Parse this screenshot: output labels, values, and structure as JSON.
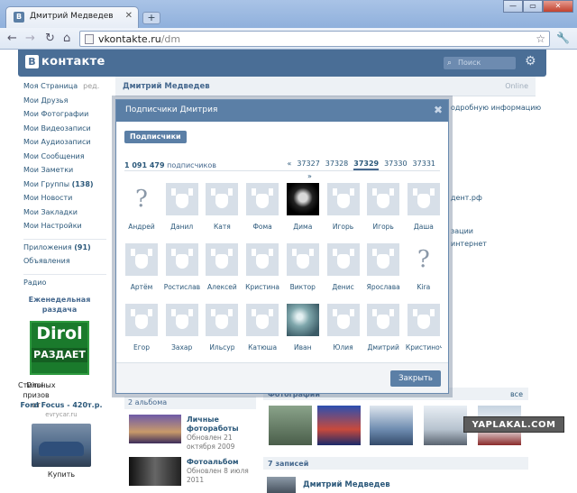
{
  "browser": {
    "tab_title": "Дмитрий Медведев",
    "tab_favicon": "В",
    "tab_close": "✕",
    "new_tab": "+",
    "window_buttons": [
      "—",
      "▭",
      "✕"
    ],
    "url_host": "vkontakte.ru",
    "url_path": "/dm",
    "icons": {
      "back": "←",
      "forward": "→",
      "reload": "↻",
      "home": "⌂",
      "star": "☆",
      "wrench": "🔧"
    }
  },
  "vk": {
    "logo_letter": "В",
    "logo_text": "контакте",
    "search_placeholder": "Поиск",
    "sidebar": [
      {
        "label": "Моя Страница",
        "aux": "ред."
      },
      {
        "label": "Мои Друзья"
      },
      {
        "label": "Мои Фотографии"
      },
      {
        "label": "Мои Видеозаписи"
      },
      {
        "label": "Мои Аудиозаписи"
      },
      {
        "label": "Мои Сообщения"
      },
      {
        "label": "Мои Заметки"
      },
      {
        "label": "Мои Группы",
        "count": "(138)"
      },
      {
        "label": "Мои Новости"
      },
      {
        "label": "Мои Закладки"
      },
      {
        "label": "Мои Настройки"
      }
    ],
    "sidebar2": [
      {
        "label": "Приложения",
        "count": "(91)"
      },
      {
        "label": "Объявления"
      }
    ],
    "sidebar3": [
      {
        "label": "Радио"
      }
    ],
    "promo": {
      "title_line1": "Еженедельная",
      "title_line2": "раздача",
      "banner_top": "Dirol",
      "banner_bottom": "РАЗДАЕТ",
      "text_line1": "Стильных призов от",
      "text_line2": "Dirol."
    },
    "ford": {
      "title": "Ford Focus - 420т.р.",
      "site": "evrycar.ru",
      "buy": "Купить"
    },
    "profile_name": "Дмитрий Медведев",
    "online": "Online",
    "fragments": {
      "f1": "одробную информацию",
      "f2": "дент.рф",
      "f3": "зации",
      "f4": "интернет"
    },
    "albums_header": "2 альбома",
    "albums": [
      {
        "title": "Личные фотоработы",
        "updated": "Обновлен 21 октября 2009"
      },
      {
        "title": "Фотоальбом",
        "updated": "Обновлен 8 июля 2011"
      }
    ],
    "photos_header": "Фотографии",
    "photos_all": "все",
    "posts_header": "7 записей",
    "poster_name": "Дмитрий Медведев"
  },
  "modal": {
    "title": "Подписчики Дмитрия",
    "close": "✖",
    "tab_label": "Подписчики",
    "count_number": "1 091 479",
    "count_label": "подписчиков",
    "pager": {
      "prev": "«",
      "pages": [
        "37327",
        "37328",
        "37329",
        "37330",
        "37331"
      ],
      "current": "37329",
      "next": "»"
    },
    "subscribers": [
      {
        "name": "Андрей",
        "avatar": "unknown"
      },
      {
        "name": "Данил",
        "avatar": "dog"
      },
      {
        "name": "Катя",
        "avatar": "dog"
      },
      {
        "name": "Фома",
        "avatar": "dog"
      },
      {
        "name": "Дима",
        "avatar": "photo-dark"
      },
      {
        "name": "Игорь",
        "avatar": "dog"
      },
      {
        "name": "Игорь",
        "avatar": "dog"
      },
      {
        "name": "Даша",
        "avatar": "dog"
      },
      {
        "name": "Артём",
        "avatar": "dog"
      },
      {
        "name": "Ростислав",
        "avatar": "dog"
      },
      {
        "name": "Алексей",
        "avatar": "dog"
      },
      {
        "name": "Кристина",
        "avatar": "dog"
      },
      {
        "name": "Виктор",
        "avatar": "dog"
      },
      {
        "name": "Денис",
        "avatar": "dog"
      },
      {
        "name": "Ярослава",
        "avatar": "dog"
      },
      {
        "name": "Kira",
        "avatar": "unknown"
      },
      {
        "name": "Егор",
        "avatar": "dog"
      },
      {
        "name": "Захар",
        "avatar": "dog"
      },
      {
        "name": "Ильсур",
        "avatar": "dog"
      },
      {
        "name": "Катюша",
        "avatar": "dog"
      },
      {
        "name": "Иван",
        "avatar": "photo-sea"
      },
      {
        "name": "Юлия",
        "avatar": "dog"
      },
      {
        "name": "Дмитрий",
        "avatar": "dog"
      },
      {
        "name": "Кристиночк",
        "avatar": "dog"
      }
    ],
    "ok_button": "Закрыть"
  },
  "watermark": "YAPLAKAL.COM",
  "colors": {
    "vk_blue": "#4a6e96",
    "link": "#2b587a",
    "modal_header": "#5b7fa6"
  }
}
